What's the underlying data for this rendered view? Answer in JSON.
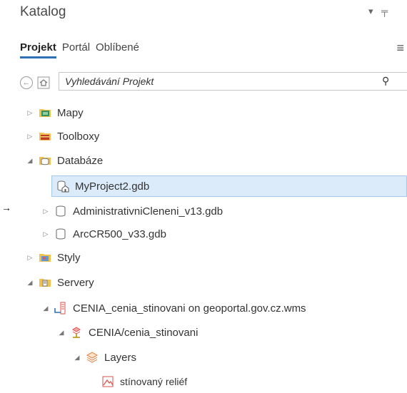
{
  "window": {
    "title": "Katalog",
    "dropdown_glyph": "▾",
    "pin_glyph": "╤"
  },
  "tabs": [
    {
      "label": "Projekt",
      "active": true
    },
    {
      "label": "Portál",
      "active": false
    },
    {
      "label": "Oblíbené",
      "active": false
    }
  ],
  "menu_glyph": "≡",
  "search": {
    "placeholder": "Vyhledávání Projekt",
    "value": ""
  },
  "tree": [
    {
      "label": "Mapy",
      "expanded": false,
      "icon": "maps-folder-icon"
    },
    {
      "label": "Toolboxy",
      "expanded": false,
      "icon": "toolbox-folder-icon"
    },
    {
      "label": "Databáze",
      "expanded": true,
      "icon": "database-folder-icon"
    },
    {
      "label": "MyProject2.gdb",
      "selected": true,
      "icon": "home-geodatabase-icon"
    },
    {
      "label": "AdministrativniCleneni_v13.gdb",
      "expanded": false,
      "icon": "geodatabase-icon"
    },
    {
      "label": "ArcCR500_v33.gdb",
      "expanded": false,
      "icon": "geodatabase-icon"
    },
    {
      "label": "Styly",
      "expanded": false,
      "icon": "styles-folder-icon"
    },
    {
      "label": "Servery",
      "expanded": true,
      "icon": "servers-folder-icon"
    },
    {
      "label": "CENIA_cenia_stinovani on geoportal.gov.cz.wms",
      "expanded": true,
      "icon": "wms-server-icon"
    },
    {
      "label": "CENIA/cenia_stinovani",
      "expanded": true,
      "icon": "service-icon"
    },
    {
      "label": "Layers",
      "expanded": true,
      "icon": "layers-icon"
    },
    {
      "label": "stínovaný reliéf",
      "icon": "raster-layer-icon"
    }
  ],
  "pointer_glyph": "→",
  "colors": {
    "accent": "#2f6fb3",
    "selection_bg": "#dcebfa",
    "folder_yellow": "#f2c14e"
  }
}
